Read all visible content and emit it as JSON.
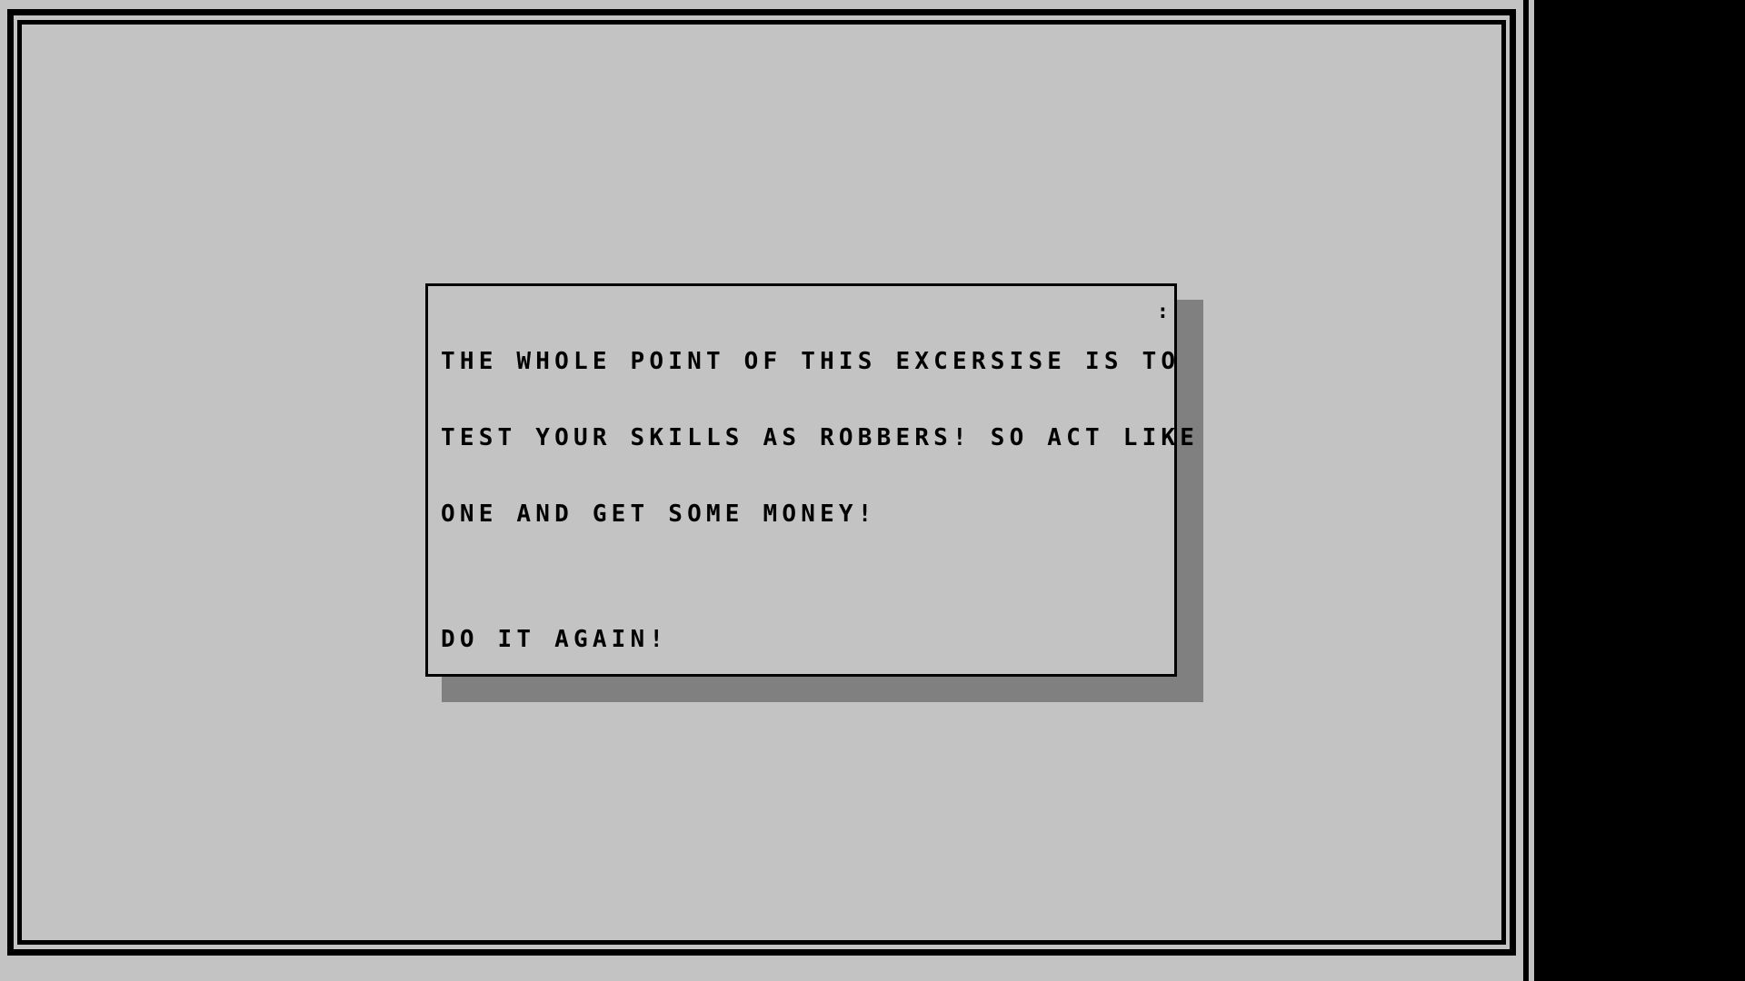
{
  "dialog": {
    "lines": [
      "THE WHOLE POINT OF THIS EXCERSISE IS TO",
      "TEST YOUR SKILLS AS ROBBERS! SO ACT LIKE",
      "ONE AND GET SOME MONEY!"
    ],
    "scroll_marker": ":",
    "action_label": "DO IT AGAIN!"
  },
  "colors": {
    "background": "#c3c3c3",
    "border": "#000000",
    "shadow": "#808080",
    "text": "#000000"
  }
}
